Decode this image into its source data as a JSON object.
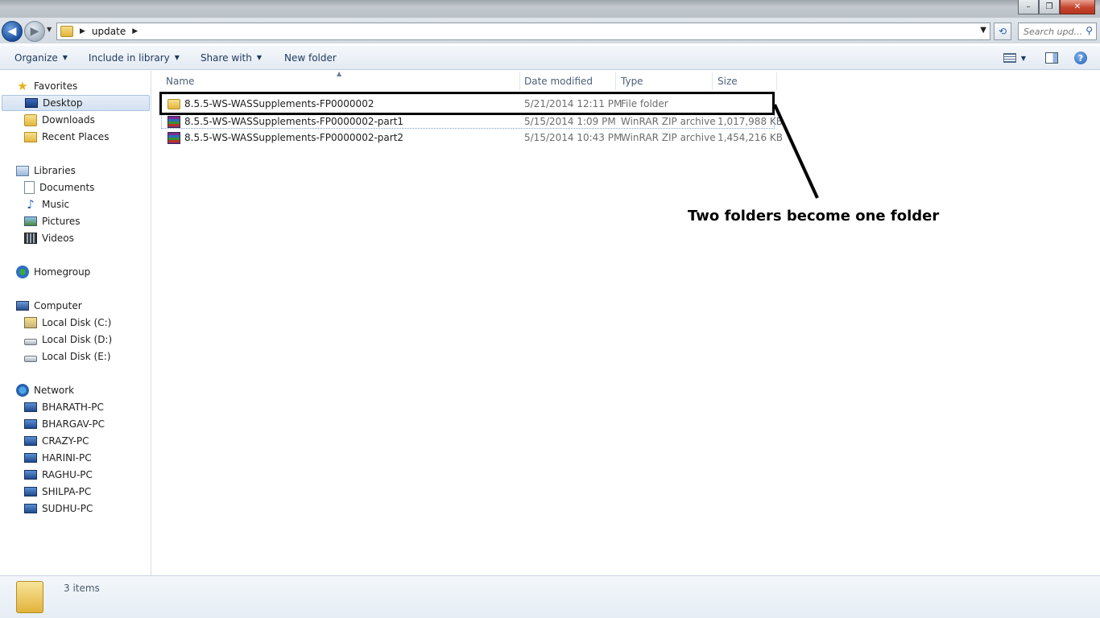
{
  "window": {
    "minimize_label": "–",
    "maximize_label": "❐",
    "close_label": "✕"
  },
  "navigation": {
    "back_label": "◀",
    "forward_label": "▶",
    "address_path": "update",
    "search_placeholder": "Search upd...",
    "refresh_label": "⟲"
  },
  "toolbar": {
    "organize_label": "Organize",
    "include_label": "Include in library",
    "share_label": "Share with",
    "new_folder_label": "New folder"
  },
  "sidebar": {
    "favorites": {
      "label": "Favorites",
      "items": [
        {
          "label": "Desktop",
          "icon": "desktop-icon",
          "selected": true
        },
        {
          "label": "Downloads",
          "icon": "downloads-icon"
        },
        {
          "label": "Recent Places",
          "icon": "recent-places-icon"
        }
      ]
    },
    "libraries": {
      "label": "Libraries",
      "items": [
        {
          "label": "Documents",
          "icon": "documents-icon"
        },
        {
          "label": "Music",
          "icon": "music-icon"
        },
        {
          "label": "Pictures",
          "icon": "pictures-icon"
        },
        {
          "label": "Videos",
          "icon": "videos-icon"
        }
      ]
    },
    "homegroup": {
      "label": "Homegroup"
    },
    "computer": {
      "label": "Computer",
      "items": [
        {
          "label": "Local Disk (C:)"
        },
        {
          "label": "Local Disk (D:)"
        },
        {
          "label": "Local Disk (E:)"
        }
      ]
    },
    "network": {
      "label": "Network",
      "items": [
        {
          "label": "BHARATH-PC"
        },
        {
          "label": "BHARGAV-PC"
        },
        {
          "label": "CRAZY-PC"
        },
        {
          "label": "HARINI-PC"
        },
        {
          "label": "RAGHU-PC"
        },
        {
          "label": "SHILPA-PC"
        },
        {
          "label": "SUDHU-PC"
        }
      ]
    }
  },
  "columns": {
    "name": "Name",
    "date_modified": "Date modified",
    "type": "Type",
    "size": "Size"
  },
  "files": [
    {
      "name": "8.5.5-WS-WASSupplements-FP0000002",
      "date": "5/21/2014 12:11 PM",
      "type": "File folder",
      "size": "",
      "icon": "folder-icon"
    },
    {
      "name": "8.5.5-WS-WASSupplements-FP0000002-part1",
      "date": "5/15/2014 1:09 PM",
      "type": "WinRAR ZIP archive",
      "size": "1,017,988 KB",
      "icon": "winrar-archive-icon"
    },
    {
      "name": "8.5.5-WS-WASSupplements-FP0000002-part2",
      "date": "5/15/2014 10:43 PM",
      "type": "WinRAR ZIP archive",
      "size": "1,454,216 KB",
      "icon": "winrar-archive-icon"
    }
  ],
  "annotation": {
    "text": "Two folders become one folder"
  },
  "details": {
    "item_count": "3 items"
  }
}
